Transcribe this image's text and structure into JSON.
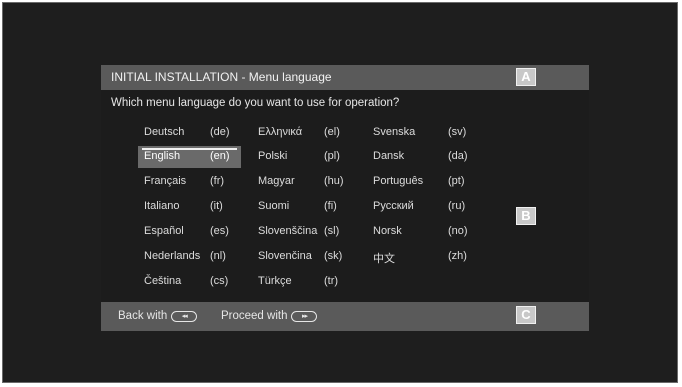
{
  "dialog": {
    "title": "INITIAL INSTALLATION - Menu language",
    "question": "Which menu language do you want to use for operation?",
    "markers": {
      "a": "A",
      "b": "B",
      "c": "C"
    },
    "languages": [
      {
        "name": "Deutsch",
        "code": "(de)"
      },
      {
        "name": "English",
        "code": "(en)",
        "selected": true
      },
      {
        "name": "Français",
        "code": "(fr)"
      },
      {
        "name": "Italiano",
        "code": "(it)"
      },
      {
        "name": "Español",
        "code": "(es)"
      },
      {
        "name": "Nederlands",
        "code": "(nl)"
      },
      {
        "name": "Čeština",
        "code": "(cs)"
      },
      {
        "name": "Ελληνικά",
        "code": "(el)"
      },
      {
        "name": "Polski",
        "code": "(pl)"
      },
      {
        "name": "Magyar",
        "code": "(hu)"
      },
      {
        "name": "Suomi",
        "code": "(fi)"
      },
      {
        "name": "Slovenščina",
        "code": "(sl)"
      },
      {
        "name": "Slovenčina",
        "code": "(sk)"
      },
      {
        "name": "Türkçe",
        "code": "(tr)"
      },
      {
        "name": "Svenska",
        "code": "(sv)"
      },
      {
        "name": "Dansk",
        "code": "(da)"
      },
      {
        "name": "Português",
        "code": "(pt)"
      },
      {
        "name": "Русский",
        "code": "(ru)"
      },
      {
        "name": "Norsk",
        "code": "(no)"
      },
      {
        "name": "中文",
        "code": "(zh)"
      }
    ],
    "footer": {
      "back_label": "Back with",
      "back_key": "◂◂",
      "proceed_label": "Proceed with",
      "proceed_key": "▸▸"
    }
  }
}
